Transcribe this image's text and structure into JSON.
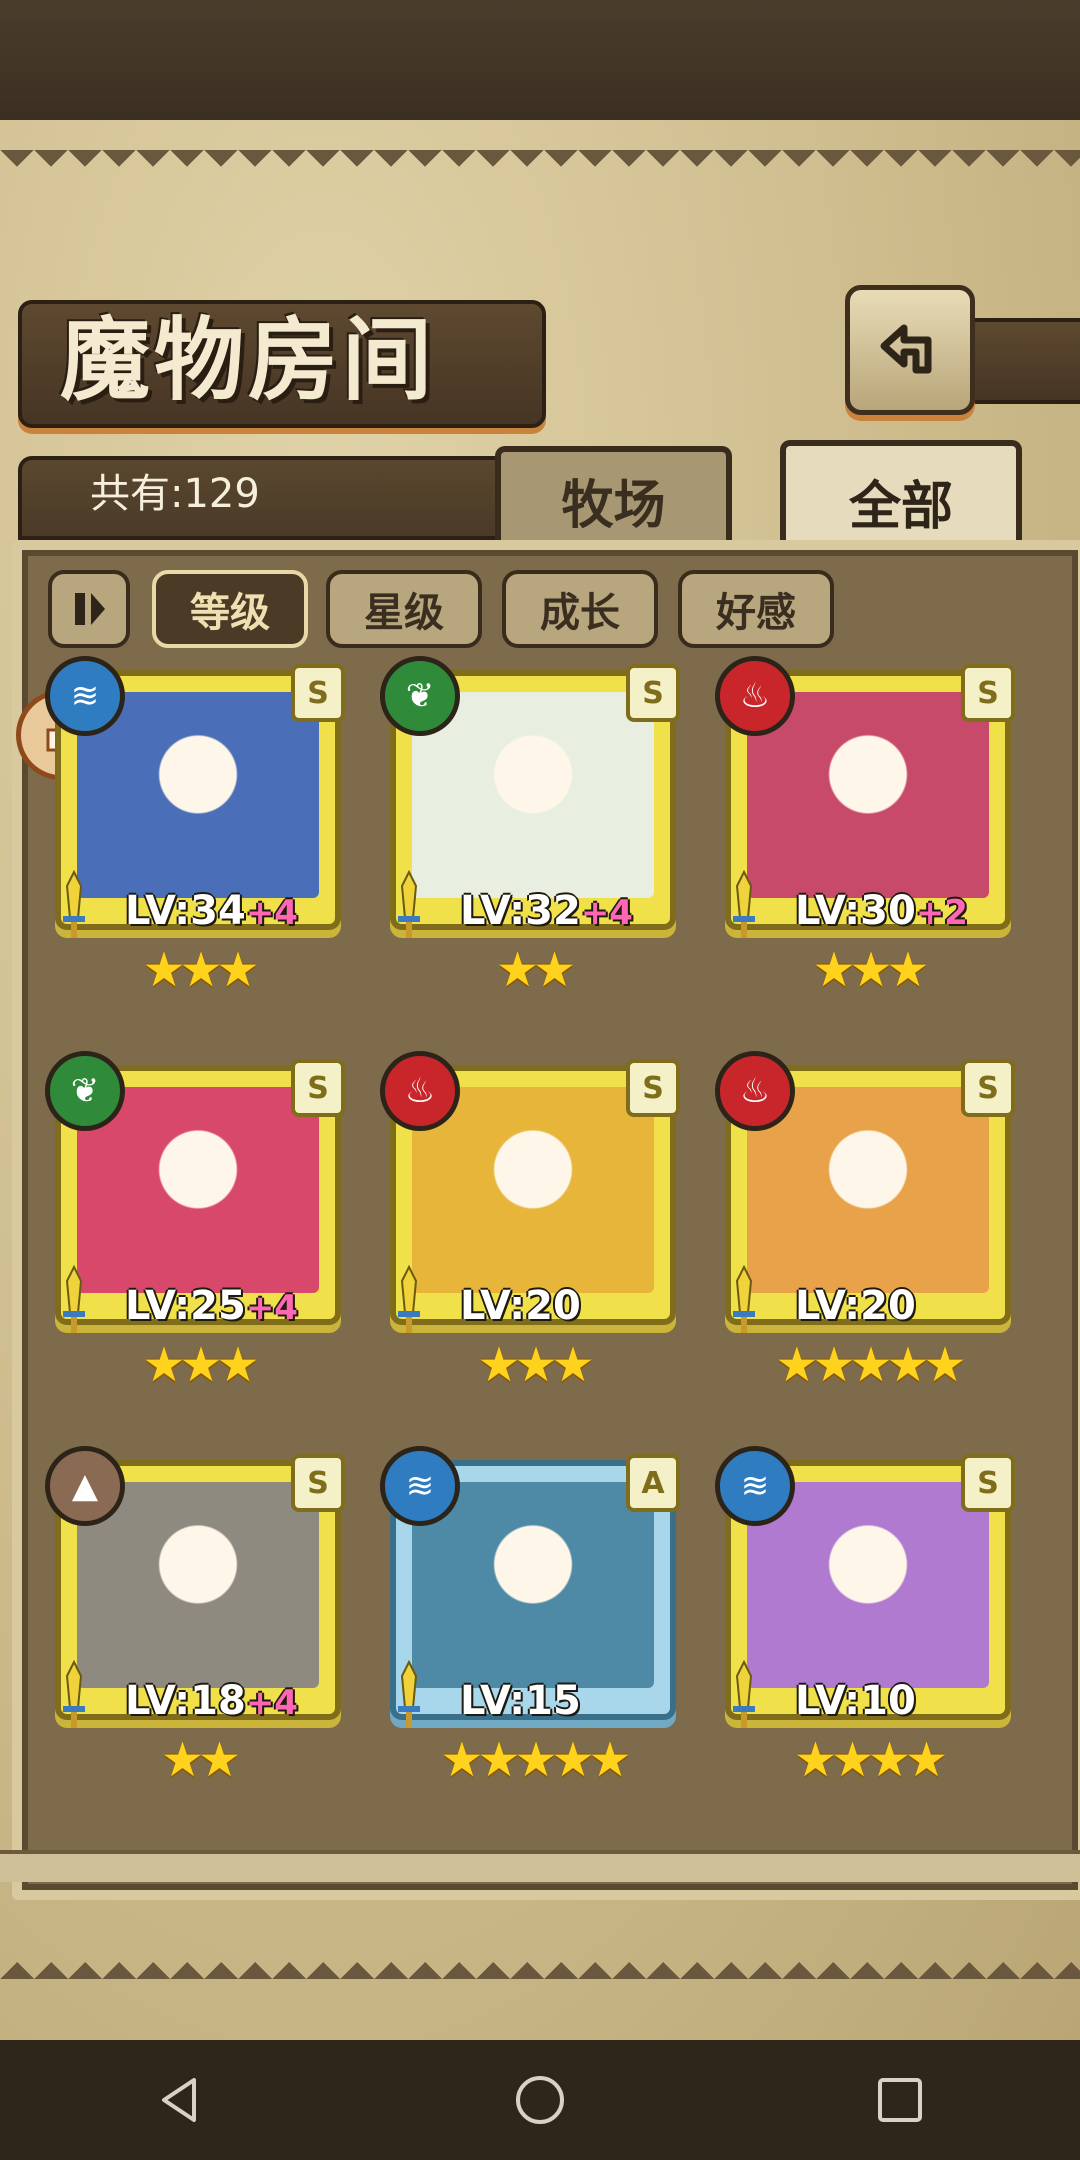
{
  "header": {
    "title": "魔物房间",
    "count_label": "共有:129"
  },
  "tabs": [
    {
      "label": "牧场"
    },
    {
      "label": "全部"
    }
  ],
  "sort": {
    "toggle_icon": "pause-icon",
    "options": [
      "等级",
      "星级",
      "成长",
      "好感"
    ],
    "active": "等级"
  },
  "colors": {
    "water": "#2f7cc0",
    "nature": "#2f8a3a",
    "fire": "#c8262a",
    "earth": "#8a6a52"
  },
  "monsters": [
    {
      "element": "water",
      "element_icon": "water-icon",
      "rank": "S",
      "level": "LV:34",
      "bonus": "+4",
      "stars": "★★★",
      "frame": "gold"
    },
    {
      "element": "nature",
      "element_icon": "leaf-icon",
      "rank": "S",
      "level": "LV:32",
      "bonus": "+4",
      "stars": "★★",
      "frame": "gold"
    },
    {
      "element": "fire",
      "element_icon": "fire-icon",
      "rank": "S",
      "level": "LV:30",
      "bonus": "+2",
      "stars": "★★★",
      "frame": "gold"
    },
    {
      "element": "nature",
      "element_icon": "leaf-icon",
      "rank": "S",
      "level": "LV:25",
      "bonus": "+4",
      "stars": "★★★",
      "frame": "gold"
    },
    {
      "element": "fire",
      "element_icon": "fire-icon",
      "rank": "S",
      "level": "LV:20",
      "bonus": "",
      "stars": "★★★",
      "frame": "gold"
    },
    {
      "element": "fire",
      "element_icon": "fire-icon",
      "rank": "S",
      "level": "LV:20",
      "bonus": "",
      "stars": "★★★★★",
      "frame": "gold"
    },
    {
      "element": "earth",
      "element_icon": "rock-icon",
      "rank": "S",
      "level": "LV:18",
      "bonus": "+4",
      "stars": "★★",
      "frame": "gold"
    },
    {
      "element": "water",
      "element_icon": "water-icon",
      "rank": "A",
      "level": "LV:15",
      "bonus": "",
      "stars": "★★★★★",
      "frame": "blue"
    },
    {
      "element": "water",
      "element_icon": "water-icon",
      "rank": "S",
      "level": "LV:10",
      "bonus": "",
      "stars": "★★★★",
      "frame": "gold"
    }
  ],
  "navbar": {
    "back_icon": "back-triangle-icon",
    "home_icon": "home-circle-icon",
    "recents_icon": "recents-square-icon"
  }
}
